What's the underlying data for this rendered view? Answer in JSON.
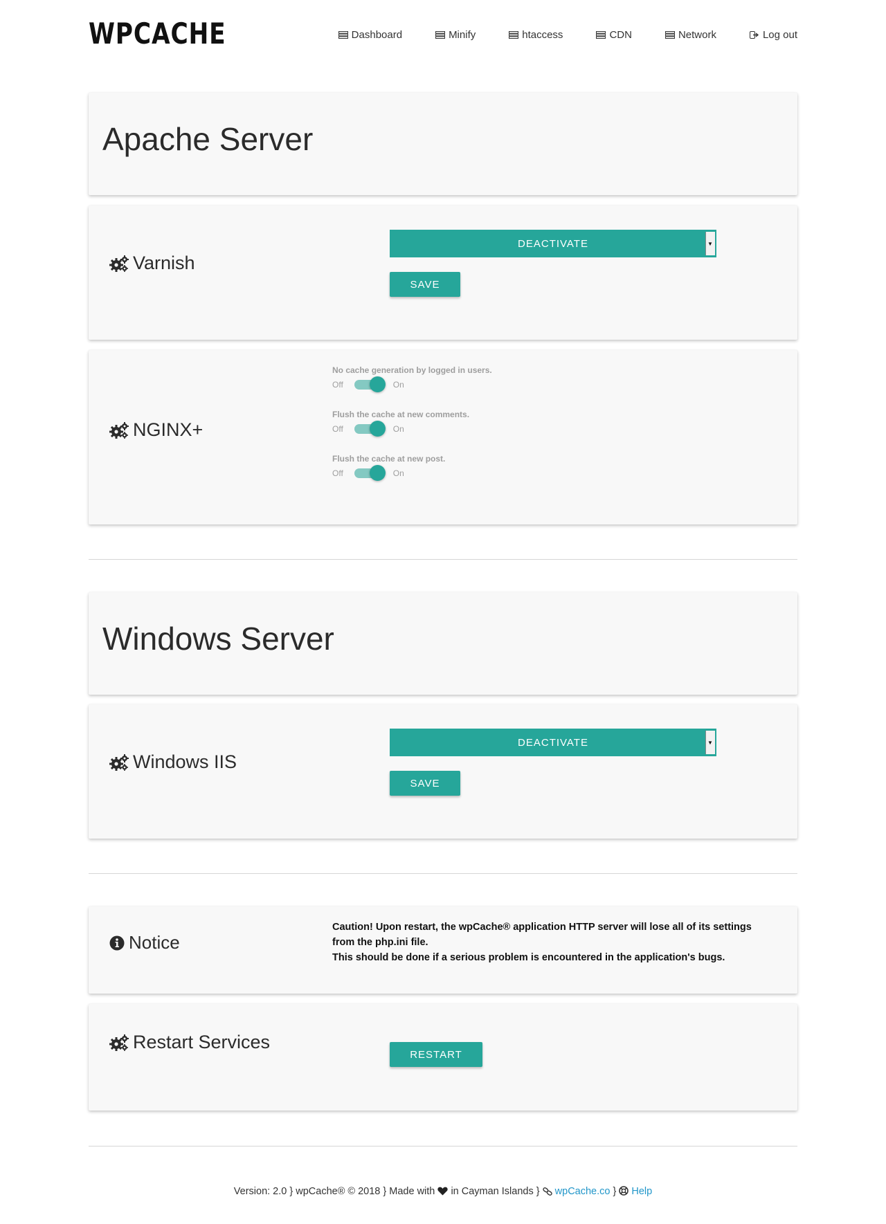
{
  "header": {
    "logo": "WPCACHE",
    "nav": [
      {
        "label": "Dashboard",
        "icon": "server-icon"
      },
      {
        "label": "Minify",
        "icon": "server-icon"
      },
      {
        "label": "htaccess",
        "icon": "server-icon"
      },
      {
        "label": "CDN",
        "icon": "server-icon"
      },
      {
        "label": "Network",
        "icon": "server-icon"
      },
      {
        "label": "Log out",
        "icon": "sign-out-icon"
      }
    ]
  },
  "apache": {
    "title": "Apache Server",
    "varnish": {
      "label": "Varnish",
      "select_value": "DEACTIVATE",
      "save_label": "SAVE"
    },
    "nginx": {
      "label": "NGINX+",
      "toggles": [
        {
          "label": "No cache generation by logged in users.",
          "off": "Off",
          "on": "On",
          "state": true
        },
        {
          "label": "Flush the cache at new comments.",
          "off": "Off",
          "on": "On",
          "state": true
        },
        {
          "label": "Flush the cache at new post.",
          "off": "Off",
          "on": "On",
          "state": true
        }
      ]
    }
  },
  "windows": {
    "title": "Windows Server",
    "iis": {
      "label": "Windows IIS",
      "select_value": "DEACTIVATE",
      "save_label": "SAVE"
    }
  },
  "notice": {
    "label": "Notice",
    "line1": "Caution! Upon restart, the wpCache® application HTTP server will lose all of its settings from the php.ini file.",
    "line2": "This should be done if a serious problem is encountered in the application's bugs."
  },
  "restart": {
    "label": "Restart Services",
    "button_label": "RESTART"
  },
  "footer": {
    "prefix": "Version: 2.0 } wpCache® © 2018 } Made with",
    "made_in": "in Cayman Islands }",
    "site_link": "wpCache.co",
    "separator": "}",
    "help_link": "Help"
  },
  "colors": {
    "accent": "#26a69a",
    "link": "#2196c9"
  }
}
